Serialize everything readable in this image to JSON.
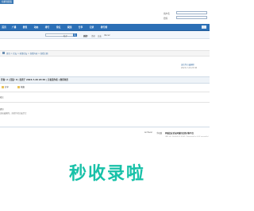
{
  "top_bar": {
    "button_label": "切换到宽版"
  },
  "header": {
    "logo_text": "",
    "login": {
      "username_label": "用户名",
      "password_label": "密码",
      "username_value": "",
      "password_value": ""
    }
  },
  "nav": {
    "items": [
      {
        "label": "首页"
      },
      {
        "label": "广播"
      },
      {
        "label": "群组"
      },
      {
        "label": "动态"
      },
      {
        "label": "排行"
      },
      {
        "label": "论坛"
      },
      {
        "label": "家园"
      },
      {
        "label": "分享"
      },
      {
        "label": "记录"
      },
      {
        "label": "排行榜"
      }
    ]
  },
  "search": {
    "placeholder": "",
    "type_label": "帖子",
    "hotwords_label": "热搜:",
    "hotwords": [
      "活动",
      "交友",
      "discuz"
    ]
  },
  "breadcrumb": {
    "text": "首页 > 论坛 > 轮滑论坛 > 查看内容 > 查看主题"
  },
  "right_panel": {
    "line1": "该信件已被删除",
    "line2": "2023-7-20 23:38"
  },
  "thread": {
    "title": "查看: 2 | 回复: 0 | 发表于 2023-7-20 23:38 | 只看该作者 | 倒序浏览",
    "actions": [
      {
        "label": "分享"
      },
      {
        "label": "收藏"
      }
    ],
    "section_label": "楼主",
    "note_heading": "提示",
    "note_text": "该帖被删除，或者作者已被禁言"
  },
  "footer": {
    "links": [
      "Archiver",
      "手机版"
    ],
    "title": "同城交友论坛同城约会找对象平台",
    "copyright": "GMT+8, 2024-4-22 05:41, Processed in 0.02 second(s)"
  },
  "watermark": {
    "text": "秒收录啦"
  }
}
